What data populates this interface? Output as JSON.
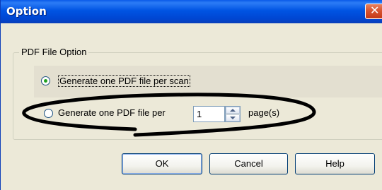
{
  "window": {
    "title": "Option",
    "close_glyph": "✕"
  },
  "group": {
    "legend": "PDF File Option",
    "option_scan_label": "Generate one PDF file per scan",
    "option_page_label": "Generate one PDF file per",
    "pages_value": "1",
    "pages_unit": "page(s)",
    "selected_option": "per-scan"
  },
  "buttons": {
    "ok": "OK",
    "cancel": "Cancel",
    "help": "Help"
  },
  "colors": {
    "titlebar": "#0054e3",
    "dialog_background": "#ece9d8",
    "annotation": "#000000"
  }
}
